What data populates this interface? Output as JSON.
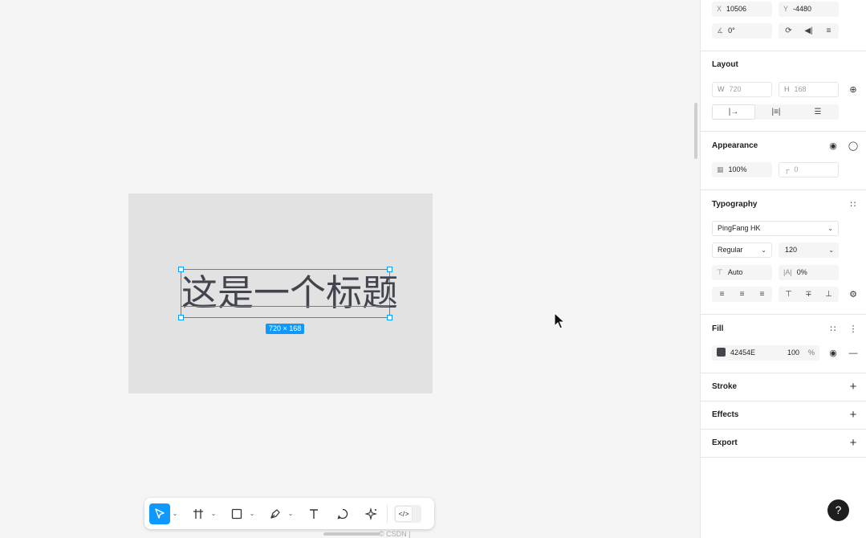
{
  "canvas": {
    "title_text": "这是一个标题",
    "size_badge": "720 × 168",
    "watermark": "© CSDN  |   "
  },
  "panel": {
    "position": {
      "x_label": "X",
      "x_value": "10506",
      "y_label": "Y",
      "y_value": "-4480",
      "rotation_value": "0°"
    },
    "layout": {
      "title": "Layout",
      "w_label": "W",
      "w_value": "720",
      "h_label": "H",
      "h_value": "168"
    },
    "appearance": {
      "title": "Appearance",
      "opacity_value": "100%",
      "radius_value": "0"
    },
    "typography": {
      "title": "Typography",
      "font_family": "PingFang HK",
      "font_weight": "Regular",
      "font_size": "120",
      "line_height": "Auto",
      "letter_spacing": "0%"
    },
    "fill": {
      "title": "Fill",
      "hex": "42454E",
      "opacity": "100",
      "opacity_unit": "%",
      "color": "#42454E"
    },
    "stroke": {
      "title": "Stroke"
    },
    "effects": {
      "title": "Effects"
    },
    "export": {
      "title": "Export"
    }
  },
  "help": {
    "label": "?"
  },
  "colors": {
    "accent": "#0d99ff",
    "frame": "#e2e2e2",
    "text": "#42454e"
  }
}
